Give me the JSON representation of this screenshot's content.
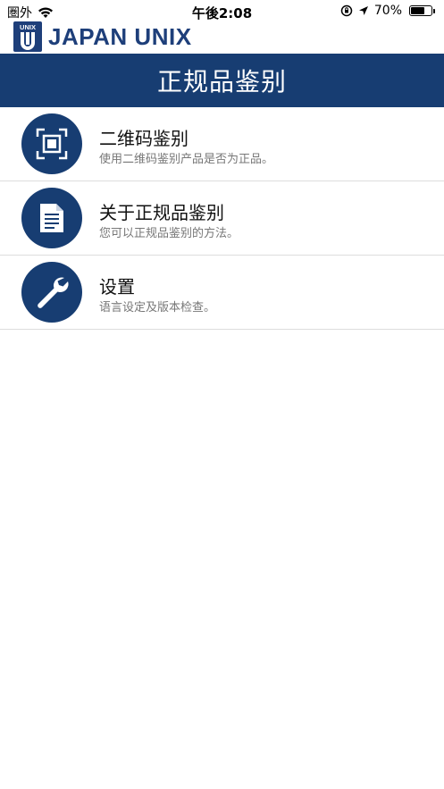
{
  "status_bar": {
    "carrier": "圏外",
    "time": "午後2:08",
    "battery_percent": "70%",
    "battery_level": 0.7
  },
  "logo": {
    "mark_text": "UNIX",
    "brand_text": "JAPAN UNIX"
  },
  "header": {
    "title": "正规品鉴别"
  },
  "menu": {
    "items": [
      {
        "icon": "qr-scan-icon",
        "title": "二维码鉴别",
        "subtitle": "使用二维码鉴别产品是否为正品。"
      },
      {
        "icon": "document-icon",
        "title": "关于正规品鉴别",
        "subtitle": "您可以正规品鉴别的方法。"
      },
      {
        "icon": "wrench-icon",
        "title": "设置",
        "subtitle": "语言设定及版本检查。"
      }
    ]
  },
  "colors": {
    "brand_navy": "#173d72",
    "logo_blue": "#1e3f7a",
    "subtitle_gray": "#777777",
    "divider": "#dddddd"
  }
}
